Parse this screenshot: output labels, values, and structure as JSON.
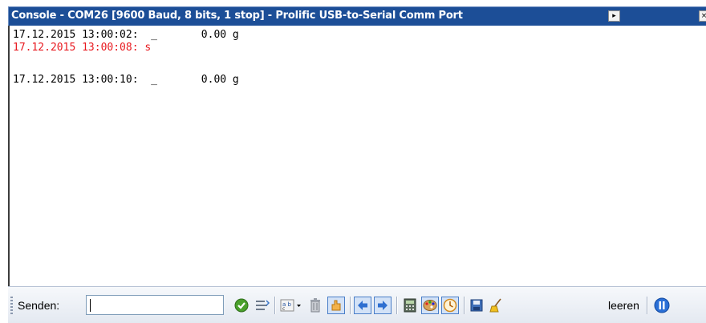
{
  "window": {
    "title": "Console - COM26 [9600 Baud, 8 bits, 1 stop] - Prolific USB-to-Serial Comm Port"
  },
  "titlebar_buttons": [
    {
      "name": "window-menu-button",
      "glyph": "▸"
    },
    {
      "name": "close-button",
      "glyph": "×"
    }
  ],
  "console": {
    "lines": [
      {
        "text": "17.12.2015 13:00:02:  _       0.00 g",
        "color": "#000000"
      },
      {
        "text": "17.12.2015 13:00:08: s",
        "color": "#e8191f"
      },
      {
        "text": "",
        "color": "#000000"
      },
      {
        "text": "17.12.2015 13:00:10:  _       0.00 g",
        "color": "#000000"
      }
    ]
  },
  "toolbar": {
    "send_label": "Senden:",
    "send_value": "",
    "clear_label": "leeren"
  },
  "colors": {
    "titlebar": "#1c4e97",
    "error_text": "#e8191f"
  }
}
